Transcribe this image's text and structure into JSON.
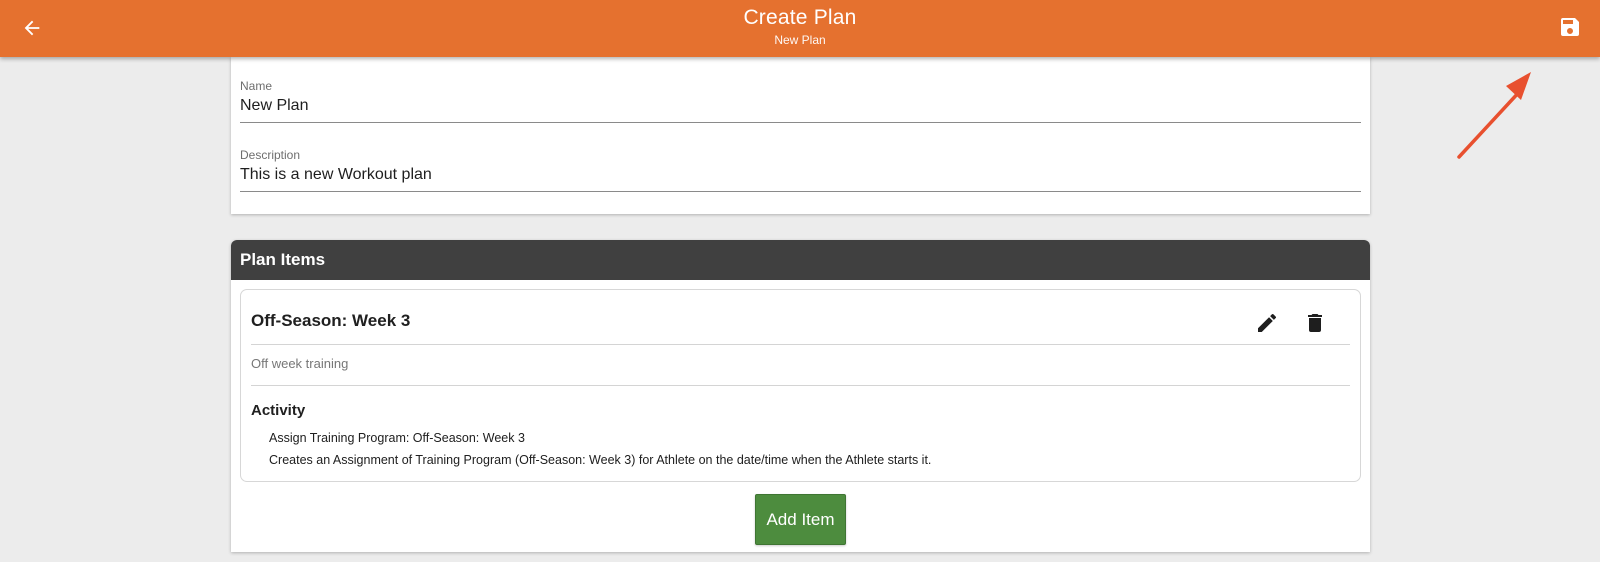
{
  "appbar": {
    "title": "Create Plan",
    "subtitle": "New Plan",
    "back_icon": "arrow-left-icon",
    "save_icon": "floppy-disk-icon",
    "color": "#e5712f"
  },
  "form": {
    "name_label": "Name",
    "name_value": "New Plan",
    "description_label": "Description",
    "description_value": "This is a new Workout plan"
  },
  "plan_items": {
    "header": "Plan Items",
    "items": [
      {
        "title": "Off-Season: Week 3",
        "description": "Off week training",
        "activity_heading": "Activity",
        "activity_lines": [
          "Assign Training Program: Off-Season: Week 3",
          "Creates an Assignment of Training Program (Off-Season: Week 3) for Athlete on the date/time when the Athlete starts it."
        ],
        "edit_icon": "pencil-icon",
        "delete_icon": "trash-icon"
      }
    ],
    "add_button_label": "Add Item",
    "add_button_color": "#4d8c3e"
  },
  "annotation": {
    "arrow_color": "#e8502f"
  }
}
